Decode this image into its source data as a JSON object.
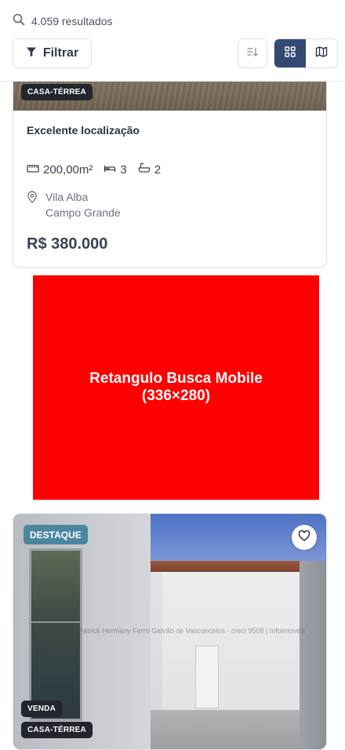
{
  "header": {
    "results_count": "4.059 resultados",
    "filter_label": "Filtrar",
    "icons": {
      "search": "search-icon",
      "filter": "funnel-icon",
      "sort": "sort-icon",
      "grid_view": "grid-icon",
      "map_view": "map-icon"
    },
    "active_view": "grid"
  },
  "listing1": {
    "type_tag": "CASA-TÉRREA",
    "title": "Excelente localização",
    "area": "200,00m²",
    "bedrooms": "3",
    "bathrooms": "2",
    "neighborhood": "Vila Alba",
    "city": "Campo Grande",
    "price": "R$ 380.000"
  },
  "ad": {
    "line1": "Retangulo Busca Mobile",
    "line2": "(336×280)",
    "color": "#ff0000"
  },
  "listing2": {
    "highlight_badge": "DESTAQUE",
    "watermark": "Informações: Patrick Hermany Ferro Galvão de Vasconcelos - creci 9508  |  Infoimoveis",
    "transaction_tag": "VENDA",
    "type_tag": "CASA-TÉRREA"
  },
  "colors": {
    "primary": "#334a73",
    "highlight": "#4b86a1",
    "tag_dark": "#22252b"
  }
}
